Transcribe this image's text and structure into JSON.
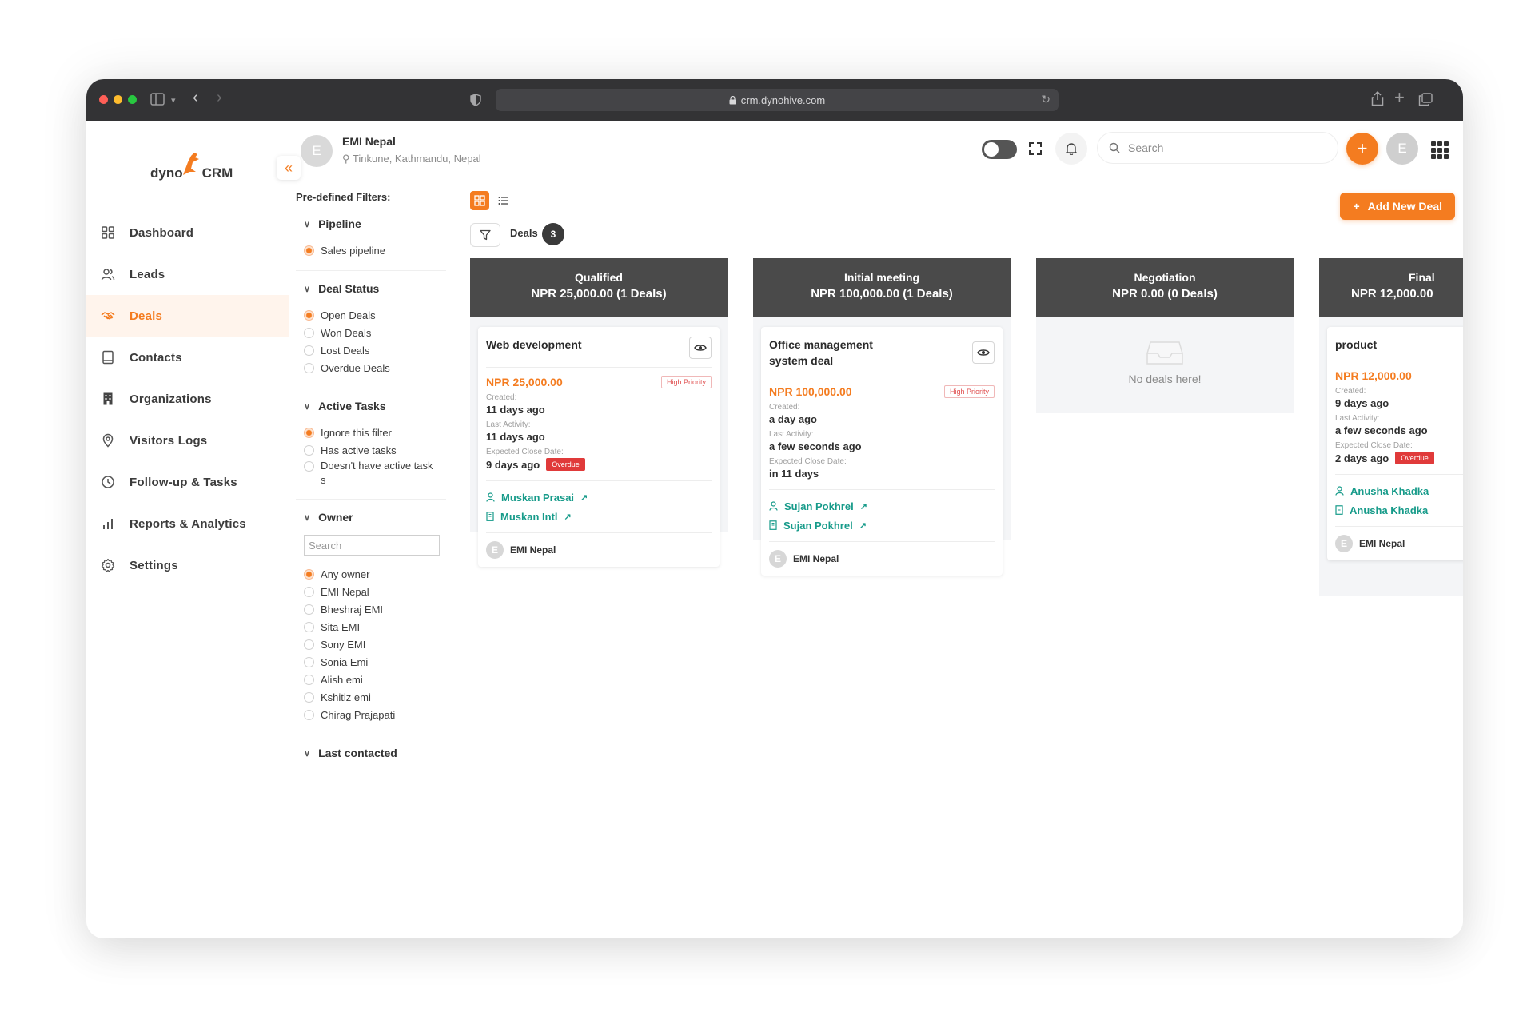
{
  "browser": {
    "url": "crm.dynohive.com",
    "traffic_colors": [
      "#ff5f57",
      "#febc2e",
      "#28c840"
    ]
  },
  "brand": {
    "logo_text_left": "dyno",
    "logo_text_right": "CRM",
    "accent": "#f47c20"
  },
  "sidebar": {
    "items": [
      {
        "label": "Dashboard",
        "icon": "dashboard-icon"
      },
      {
        "label": "Leads",
        "icon": "users-icon"
      },
      {
        "label": "Deals",
        "icon": "handshake-icon",
        "active": true
      },
      {
        "label": "Contacts",
        "icon": "contact-book-icon"
      },
      {
        "label": "Organizations",
        "icon": "building-icon"
      },
      {
        "label": "Visitors Logs",
        "icon": "location-pin-icon"
      },
      {
        "label": "Follow-up & Tasks",
        "icon": "clock-icon"
      },
      {
        "label": "Reports & Analytics",
        "icon": "bar-chart-icon"
      },
      {
        "label": "Settings",
        "icon": "gear-icon"
      }
    ]
  },
  "header": {
    "org_initial": "E",
    "org_name": "EMI Nepal",
    "org_location": "Tinkune, Kathmandu, Nepal",
    "search_placeholder": "Search",
    "user_initial": "E"
  },
  "filters": {
    "title": "Pre-defined Filters:",
    "pipeline": {
      "label": "Pipeline",
      "options": [
        "Sales pipeline"
      ],
      "selected": 0
    },
    "deal_status": {
      "label": "Deal Status",
      "options": [
        "Open Deals",
        "Won Deals",
        "Lost Deals",
        "Overdue Deals"
      ],
      "selected": 0
    },
    "active_tasks": {
      "label": "Active Tasks",
      "options": [
        "Ignore this filter",
        "Has active tasks",
        "Doesn't have active task s"
      ],
      "selected": 0
    },
    "owner": {
      "label": "Owner",
      "search_placeholder": "Search",
      "options": [
        "Any owner",
        "EMI Nepal",
        "Bheshraj EMI",
        "Sita EMI",
        "Sony EMI",
        "Sonia Emi",
        "Alish emi",
        "Kshitiz emi",
        "Chirag Prajapati"
      ],
      "selected": 0
    },
    "last_contacted": {
      "label": "Last contacted"
    }
  },
  "board": {
    "deals_label": "Deals",
    "deals_count": "3",
    "add_button": "Add New Deal",
    "columns": [
      {
        "title": "Qualified",
        "summary": "NPR 25,000.00 (1 Deals)",
        "card": {
          "title": "Web development",
          "amount": "NPR 25,000.00",
          "priority": "High Priority",
          "created_label": "Created:",
          "created": "11 days ago",
          "activity_label": "Last Activity:",
          "activity": "11 days ago",
          "close_label": "Expected Close Date:",
          "close": "9 days ago",
          "overdue": "Overdue",
          "contact": "Muskan Prasai",
          "organization": "Muskan Intl",
          "owner": "EMI Nepal",
          "owner_initial": "E"
        }
      },
      {
        "title": "Initial meeting",
        "summary": "NPR 100,000.00 (1 Deals)",
        "card": {
          "title": "Office management system deal",
          "amount": "NPR 100,000.00",
          "priority": "High Priority",
          "created_label": "Created:",
          "created": "a day ago",
          "activity_label": "Last Activity:",
          "activity": "a few seconds ago",
          "close_label": "Expected Close Date:",
          "close": "in 11 days",
          "contact": "Sujan Pokhrel",
          "organization": "Sujan Pokhrel",
          "owner": "EMI Nepal",
          "owner_initial": "E"
        }
      },
      {
        "title": "Negotiation",
        "summary": "NPR 0.00 (0 Deals)",
        "empty_text": "No deals here!"
      },
      {
        "title": "Final",
        "summary": "NPR 12,000.00",
        "card": {
          "title": "product",
          "amount": "NPR 12,000.00",
          "created_label": "Created:",
          "created": "9 days ago",
          "activity_label": "Last Activity:",
          "activity": "a few seconds ago",
          "close_label": "Expected Close Date:",
          "close": "2 days ago",
          "overdue": "Overdue",
          "contact": "Anusha Khadka",
          "organization": "Anusha Khadka",
          "owner": "EMI Nepal",
          "owner_initial": "E"
        }
      }
    ]
  }
}
